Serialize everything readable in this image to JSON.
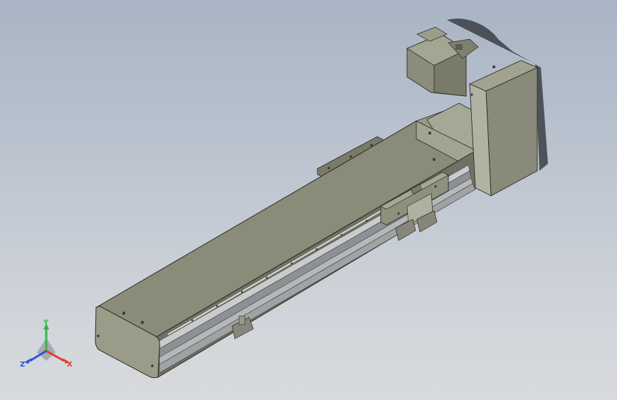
{
  "viewport": {
    "background_top": "#a9b4c4",
    "background_bottom": "#d8dadd"
  },
  "model": {
    "body_color": "#8d8d7c",
    "body_dark": "#6e6e60",
    "rail_color": "#b9bdbf",
    "edge_color": "#2a2a26"
  },
  "triad": {
    "x_label": "X",
    "y_label": "Y",
    "z_label": "Z",
    "x_color": "#e23b2c",
    "y_color": "#38b54a",
    "z_color": "#2f55d4"
  }
}
